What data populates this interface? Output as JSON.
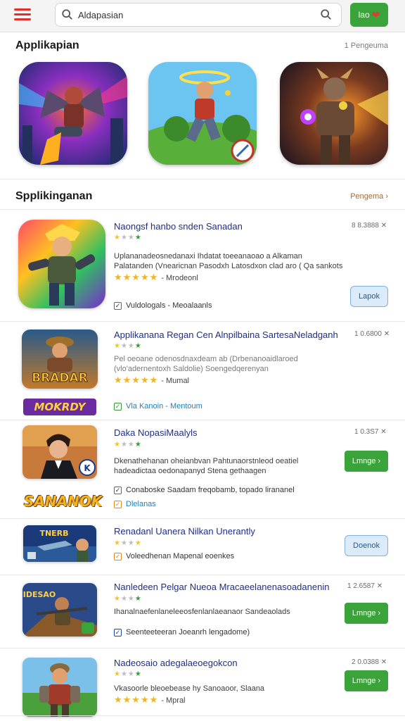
{
  "header": {
    "search_value": "Aldapasian",
    "action_label": "lao"
  },
  "featured": {
    "title": "Applikapian",
    "more": "1 Pengeuma"
  },
  "list": {
    "title": "Spplikinganan",
    "more": "Pengema ›",
    "items": [
      {
        "title": "Naongsf hanbo snden Sanadan",
        "meta": "8 8.3888 ✕",
        "desc1": "Uplananadeosnedanaxi Ihdatat toeeanaoao a Alkaman",
        "desc2": "Palatanden (Vnearicnan  Pasodxh  Latosdxon clad aro ( Qa sankots",
        "rating_label": "- Mrodeonl",
        "check": "Vuldologals - Meoalaanls",
        "button": "Lapok"
      },
      {
        "title": "Applikanana Regan Cen Alnpilbaina SartesaNeladganh",
        "meta": "1 0.6800 ✕",
        "desc1": "Pel oeoane odenosdnaxdeam ab (Drbenanoaidlaroed",
        "desc2": "(vlo'adernentoxh  Saldolie)  Soengedqerenyan",
        "rating_label": "- Mumal",
        "banner": "BRADAR",
        "banner2": "MOKRDY",
        "check": "Vla Kanoin  -  Mentoum"
      },
      {
        "title": "Daka NopasiMaalyls",
        "meta": "1 0.3S7 ✕",
        "desc1": "Dkenathehanan  oheianbvan  Pahtunaorstnleod oeatiel",
        "desc2": "hadeadictaa  oedonapanyd  Stena  gethaagen",
        "check": "Conaboske  Saadam  freqobamb,  topado  lirananel",
        "check2": "Dlelanas",
        "button": "Lmnge",
        "banner": "SANANOK"
      },
      {
        "title": "Renadanl Uanera Nilkan Unerantly",
        "check": "Voleedhenan  Mapenal  eoenkes",
        "button": "Doenok",
        "banner": "TNERB"
      },
      {
        "title": "Nanledeen Pelgar Nueoa Mracaeelanenasoadanenin",
        "meta": "1 2.6587 ✕",
        "desc1": "Ihanalnaefenlaneleeosfenlanlaeanaor  Sandeaolads",
        "check": "Seenteeteeran  Joeanrh  lengadome)",
        "button": "Lmnge",
        "banner": "IDESAO"
      },
      {
        "title": "Nadeosaio adegalaeoegokcon",
        "meta": "2 0.0388 ✕",
        "desc1": "Vkasoorle  bleoebease  hy  Sanoaoor,  Slaana",
        "rating_label": "- Mpral",
        "button": "Lmnge"
      }
    ]
  },
  "colors": {
    "accent_red": "#e0302b",
    "button_green": "#3aa43a",
    "title_blue": "#1f2e8a",
    "star_yellow": "#f2b51f"
  }
}
